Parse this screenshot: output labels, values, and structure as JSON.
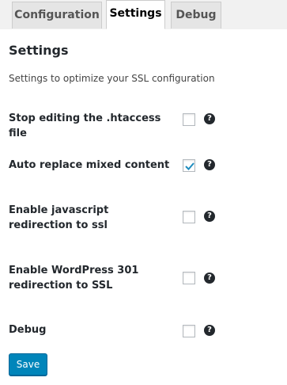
{
  "tabs": [
    {
      "label": "Configuration",
      "active": false
    },
    {
      "label": "Settings",
      "active": true
    },
    {
      "label": "Debug",
      "active": false
    }
  ],
  "panel": {
    "title": "Settings",
    "description": "Settings to optimize your SSL configuration"
  },
  "settings": [
    {
      "label": "Stop editing the .htaccess file",
      "checked": false,
      "help": "?"
    },
    {
      "label": "Auto replace mixed content",
      "checked": true,
      "help": "?"
    },
    {
      "label": "Enable javascript redirection to ssl",
      "checked": false,
      "help": "?"
    },
    {
      "label": "Enable WordPress 301 redirection to SSL",
      "checked": false,
      "help": "?"
    },
    {
      "label": "Debug",
      "checked": false,
      "help": "?"
    }
  ],
  "save_label": "Save",
  "colors": {
    "accent": "#0085ba",
    "check": "#1e8cbe"
  }
}
